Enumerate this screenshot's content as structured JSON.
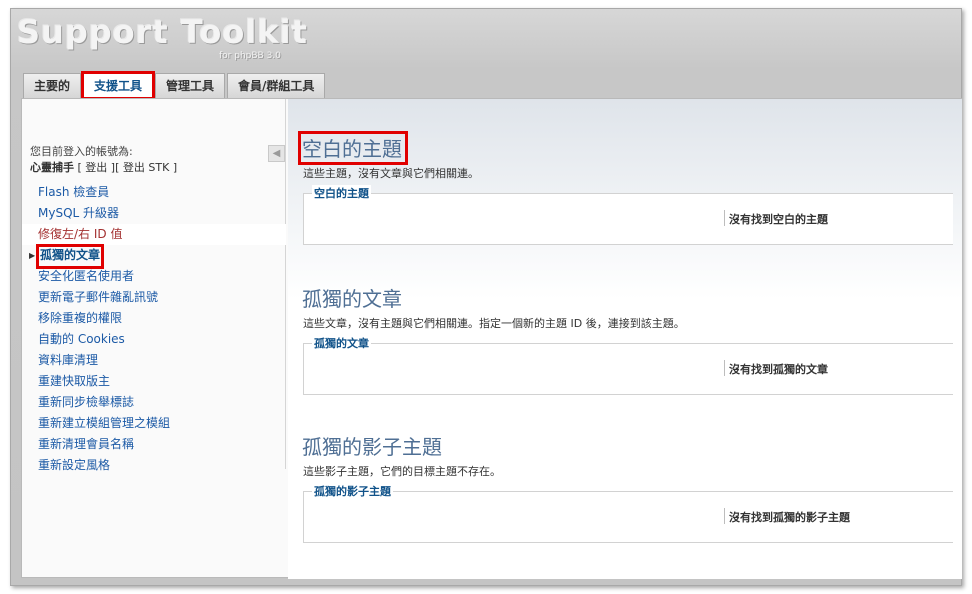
{
  "header": {
    "logo_text": "Support Toolkit",
    "logo_sub": "for phpBB 3.0"
  },
  "tabs": [
    {
      "label": "主要的"
    },
    {
      "label": "支援工具",
      "active": true
    },
    {
      "label": "管理工具"
    },
    {
      "label": "會員/群組工具"
    }
  ],
  "sidebar": {
    "login_label": "您目前登入的帳號為:",
    "username": "心靈捕手",
    "logout_link": "登出",
    "logout_stk_link": "登出 STK",
    "collapse_icon": "◀",
    "items": [
      {
        "label": "Flash 檢查員"
      },
      {
        "label": "MySQL 升級器"
      },
      {
        "label": "修復左/右 ID 值"
      },
      {
        "label": "孤獨的文章",
        "current": true
      },
      {
        "label": "安全化匿名使用者"
      },
      {
        "label": "更新電子郵件雜亂訊號"
      },
      {
        "label": "移除重複的權限"
      },
      {
        "label": "自動的 Cookies"
      },
      {
        "label": "資料庫清理"
      },
      {
        "label": "重建快取版主"
      },
      {
        "label": "重新同步檢舉標誌"
      },
      {
        "label": "重新建立模組管理之模組"
      },
      {
        "label": "重新清理會員名稱"
      },
      {
        "label": "重新設定風格"
      }
    ]
  },
  "sections": [
    {
      "title": "空白的主題",
      "description": "這些主題，沒有文章與它們相關連。",
      "box_legend": "空白的主題",
      "message": "沒有找到空白的主題"
    },
    {
      "title": "孤獨的文章",
      "description": "這些文章，沒有主題與它們相關連。指定一個新的主題 ID 後，連接到該主題。",
      "box_legend": "孤獨的文章",
      "message": "沒有找到孤獨的文章"
    },
    {
      "title": "孤獨的影子主題",
      "description": "這些影子主題，它們的目標主題不存在。",
      "box_legend": "孤獨的影子主題",
      "message": "沒有找到孤獨的影子主題"
    }
  ],
  "colors": {
    "accent": "#105289",
    "link": "#1c5aa6",
    "highlight_outline": "#e00000"
  }
}
